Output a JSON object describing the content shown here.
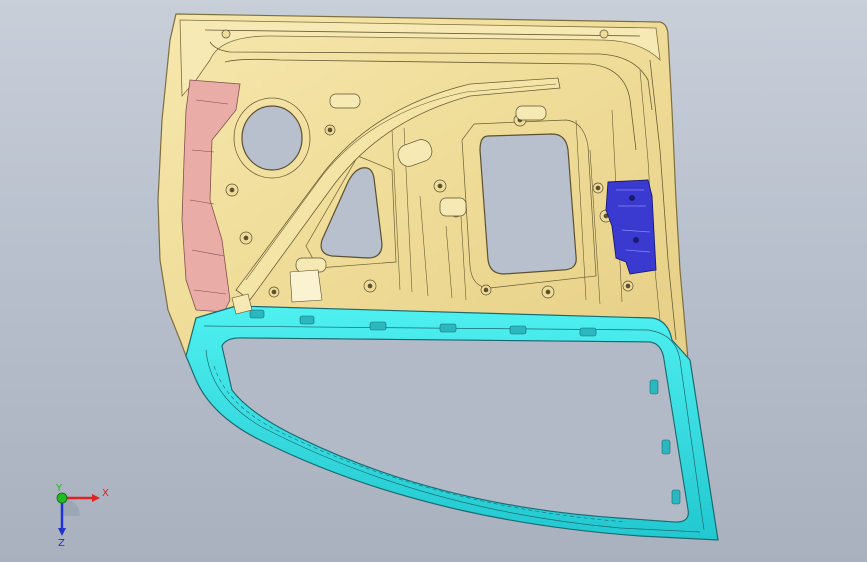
{
  "viewport": {
    "background_top": "#c9cfd9",
    "background_bottom": "#a9b1bf"
  },
  "model": {
    "inner_panel_color": "#f3e2a0",
    "panel_edge_color": "#8a7a45",
    "hinge_reinforcement_color": "#e8a9a9",
    "window_frame_color": "#33e0e0",
    "latch_bracket_color": "#3333cc"
  },
  "triad": {
    "x_label": "X",
    "y_label": "Y",
    "z_label": "Z",
    "x_color": "#dd2222",
    "y_color": "#22bb22",
    "z_color": "#2233cc"
  }
}
